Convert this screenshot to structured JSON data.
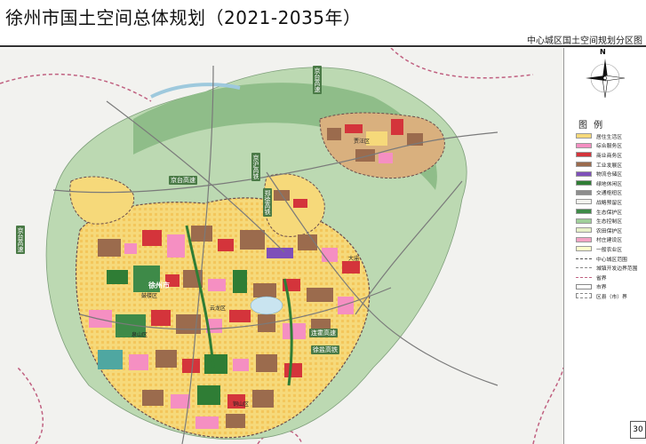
{
  "header": {
    "title": "徐州市国土空间总体规划（2021-2035年）",
    "subtitle": "中心城区国土空间规划分区图"
  },
  "compass": {
    "north": "N"
  },
  "legend": {
    "title": "图 例",
    "items": [
      {
        "label": "居住生活区",
        "color": "#f6d97a"
      },
      {
        "label": "综合服务区",
        "color": "#f58fc2"
      },
      {
        "label": "商业商务区",
        "color": "#d4343b"
      },
      {
        "label": "工业发展区",
        "color": "#9b6b4d"
      },
      {
        "label": "物流仓储区",
        "color": "#7e4fb9"
      },
      {
        "label": "绿地休闲区",
        "color": "#2f7d35"
      },
      {
        "label": "交通枢纽区",
        "color": "#8d8d8d"
      },
      {
        "label": "战略预留区",
        "color": "#f2f2ee"
      },
      {
        "label": "生态保护区",
        "color": "#3e8a48"
      },
      {
        "label": "生态控制区",
        "color": "#9fcf9a"
      },
      {
        "label": "农田保护区",
        "color": "#e7f1c8"
      },
      {
        "label": "村庄建设区",
        "color": "#f3a3c4"
      },
      {
        "label": "一般农业区",
        "color": "#ffffcc"
      },
      {
        "label": "中心城区范围",
        "color": "#555555",
        "style": "dash"
      },
      {
        "label": "城镇开发边界范围",
        "color": "#888888",
        "style": "dash"
      },
      {
        "label": "省界",
        "color": "#c06080",
        "style": "dash"
      },
      {
        "label": "市界",
        "color": "#888888",
        "style": "outline"
      },
      {
        "label": "区县（市）界",
        "color": "#888888",
        "style": "dashbox"
      }
    ]
  },
  "map": {
    "road_labels": [
      "京台高速",
      "京沪高铁",
      "郑徐高铁",
      "京台高速",
      "连霍高速",
      "徐盐高铁",
      "京台高速"
    ],
    "city_name": "徐州市",
    "district_names": [
      "鼓楼区",
      "泉山区",
      "云龙区",
      "铜山区",
      "贾汪区",
      "大庙"
    ]
  },
  "page": {
    "number": "30"
  }
}
